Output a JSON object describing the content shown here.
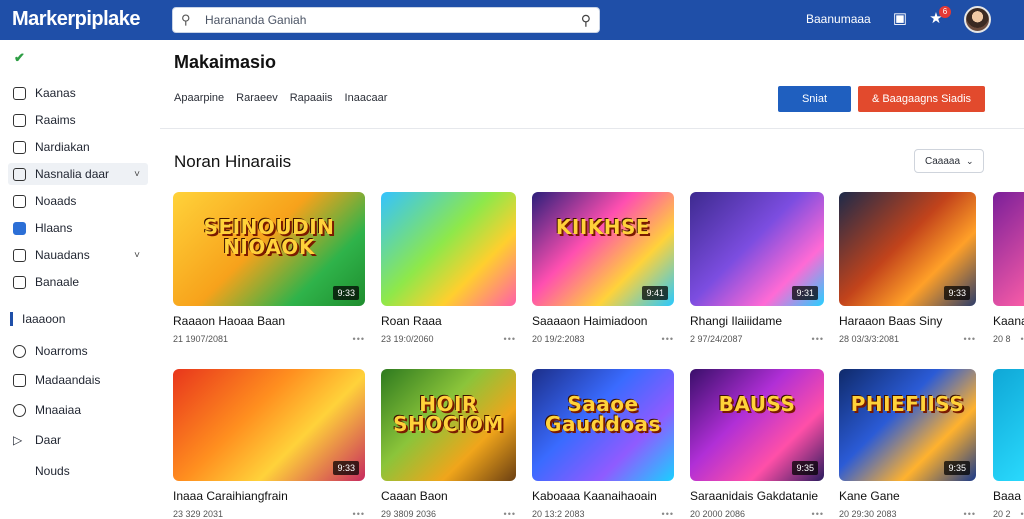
{
  "app": {
    "logo": "Markerpiplake",
    "search_placeholder": "Harananda Ganiah",
    "top_link": "Baanumaaa"
  },
  "colors": {
    "topbar": "#1f4fa8",
    "primary_button": "#1f5fbf",
    "accent_button": "#e24a2d"
  },
  "sidebar": {
    "items": [
      {
        "label": "Kaanas",
        "icon": "square-outline-icon"
      },
      {
        "label": "Raaims",
        "icon": "bookmark-icon"
      },
      {
        "label": "Nardiakan",
        "icon": "folder-icon"
      },
      {
        "label": "Nasnalia daar",
        "icon": "panel-icon",
        "active": true
      },
      {
        "label": "Noaads",
        "icon": "document-icon"
      },
      {
        "label": "Hlaans",
        "icon": "checkbox-icon"
      },
      {
        "label": "Nauadans",
        "icon": "square-outline-icon"
      },
      {
        "label": "Banaale",
        "icon": "gift-icon"
      }
    ],
    "section_label": "Iaaaoon",
    "items2": [
      {
        "label": "Noarroms",
        "icon": "shield-icon"
      },
      {
        "label": "Madaandais",
        "icon": "tag-icon"
      },
      {
        "label": "Mnaaiaa",
        "icon": "clock-icon"
      },
      {
        "label": "Daar",
        "icon": "play-icon"
      },
      {
        "label": "Nouds",
        "icon": "none"
      }
    ]
  },
  "main": {
    "title": "Makaimasio",
    "tabs": [
      "Apaarpine",
      "Raraeev",
      "Rapaaiis",
      "Inaacaar"
    ],
    "primary_button": "Sniat",
    "accent_button": "& Baagaagns Siadis",
    "section_title": "Noran Hinaraiis",
    "sort_label": "Caaaaa"
  },
  "cards": [
    {
      "title": "Raaaon Haoaa Baan",
      "meta": "21 1907/2081",
      "duration": "9:33",
      "art": "SEINOUDIN NIOAOK"
    },
    {
      "title": "Roan Raaa",
      "meta": "23 19:0/2060",
      "duration": "",
      "art": ""
    },
    {
      "title": "Saaaaon Haimiadoon",
      "meta": "20 19/2:2083",
      "duration": "9:41",
      "art": "KIIKHSE"
    },
    {
      "title": "Rhangi Ilaiiidame",
      "meta": "2 97/24/2087",
      "duration": "9:31",
      "art": ""
    },
    {
      "title": "Haraaon Baas Siny",
      "meta": "28 03/3/3:2081",
      "duration": "9:33",
      "art": ""
    },
    {
      "title": "Kaana",
      "meta": "20 8",
      "duration": "",
      "art": ""
    },
    {
      "title": "Inaaa Caraihiangfrain",
      "meta": "23 329 2031",
      "duration": "9:33",
      "art": ""
    },
    {
      "title": "Caaan Baon",
      "meta": "29 3809 2036",
      "duration": "",
      "art": "HOIR SHOCIOM"
    },
    {
      "title": "Kaboaaa Kaanaihaoain",
      "meta": "20 13:2 2083",
      "duration": "",
      "art": "Saaoe Gauddoas"
    },
    {
      "title": "Saraanidais Gakdatanie",
      "meta": "20 2000 2086",
      "duration": "9:35",
      "art": "BAUSS"
    },
    {
      "title": "Kane Gane",
      "meta": "20 29:30 2083",
      "duration": "9:35",
      "art": "PHIEFIISS"
    },
    {
      "title": "Baaa",
      "meta": "20 2",
      "duration": "",
      "art": ""
    }
  ]
}
